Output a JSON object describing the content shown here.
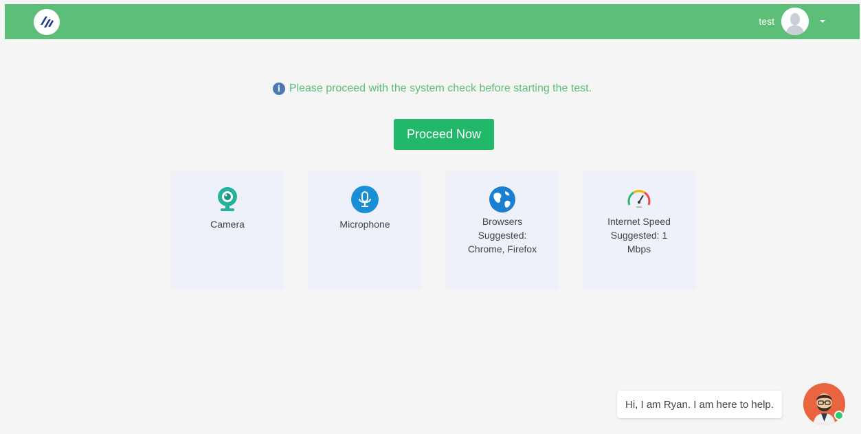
{
  "header": {
    "user_name": "test",
    "colors": {
      "bar": "#5dbe77"
    }
  },
  "notice": {
    "text": "Please proceed with the system check before starting the test.",
    "icon": "info-icon"
  },
  "proceed_button": {
    "label": "Proceed Now",
    "color": "#22b86a"
  },
  "checks": [
    {
      "name": "camera",
      "icon": "webcam-icon",
      "lines": [
        "Camera"
      ]
    },
    {
      "name": "microphone",
      "icon": "microphone-icon",
      "lines": [
        "Microphone"
      ]
    },
    {
      "name": "browsers",
      "icon": "globe-icon",
      "lines": [
        "Browsers",
        "Suggested:",
        "Chrome, Firefox"
      ]
    },
    {
      "name": "internet-speed",
      "icon": "speedometer-icon",
      "lines": [
        "Internet Speed",
        "Suggested: 1",
        "Mbps"
      ]
    }
  ],
  "chat": {
    "message": "Hi, I am Ryan. I am here to help.",
    "status_color": "#2ecc71"
  }
}
